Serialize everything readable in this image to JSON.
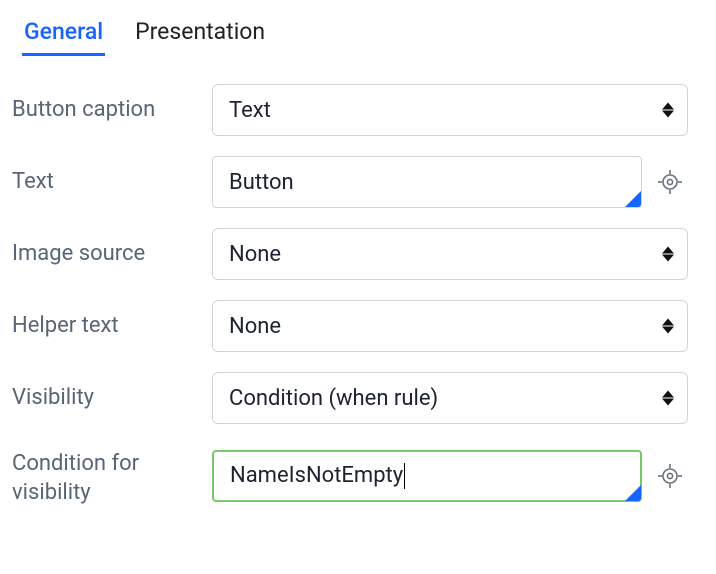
{
  "tabs": {
    "general": "General",
    "presentation": "Presentation"
  },
  "labels": {
    "button_caption": "Button caption",
    "text": "Text",
    "image_source": "Image source",
    "helper_text": "Helper text",
    "visibility": "Visibility",
    "condition_for_visibility": "Condition for visibility"
  },
  "values": {
    "button_caption": "Text",
    "text": "Button",
    "image_source": "None",
    "helper_text": "None",
    "visibility": "Condition (when rule)",
    "condition_for_visibility": "NameIsNotEmpty"
  }
}
